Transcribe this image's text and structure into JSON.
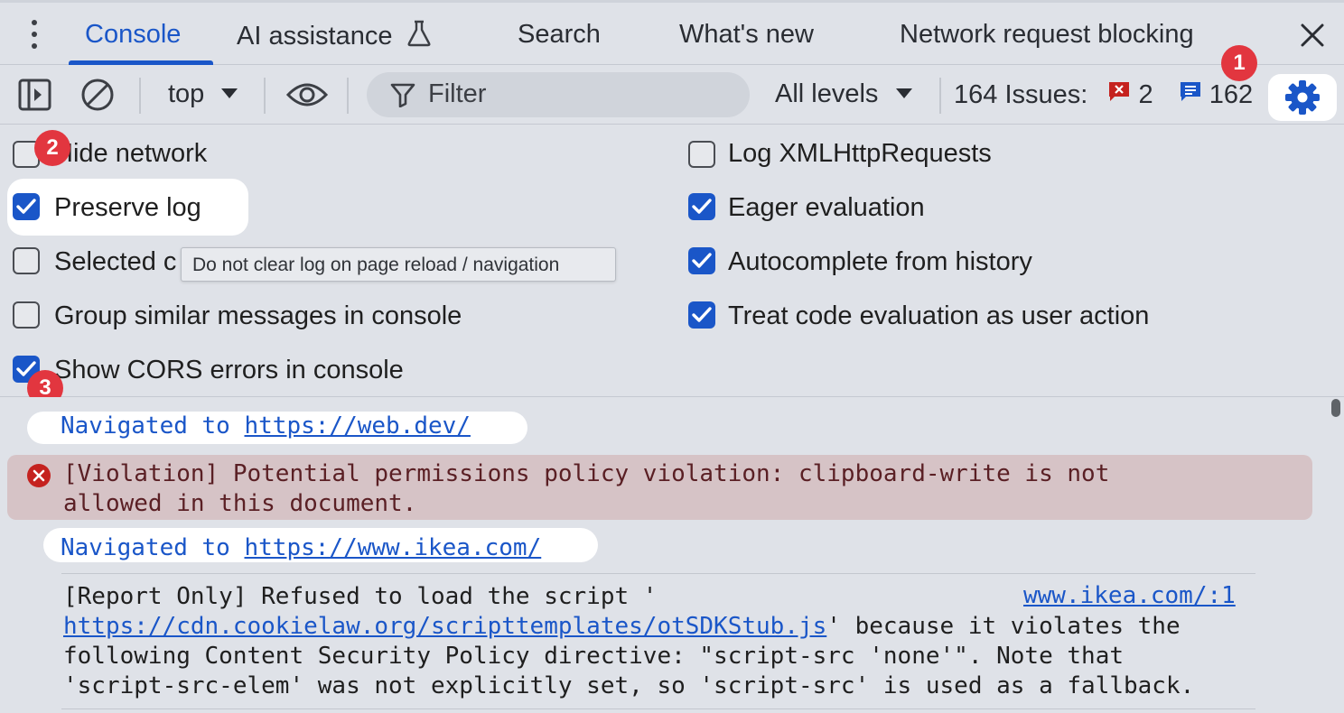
{
  "tabs": {
    "items": [
      {
        "label": "Console",
        "active": true
      },
      {
        "label": "AI assistance"
      },
      {
        "label": "Search"
      },
      {
        "label": "What's new"
      },
      {
        "label": "Network request blocking"
      }
    ]
  },
  "toolbar": {
    "context": "top",
    "filter_placeholder": "Filter",
    "levels": "All levels",
    "issues_label": "164 Issues:",
    "errors_count": "2",
    "info_count": "162"
  },
  "badges": {
    "one": "1",
    "two": "2",
    "three": "3"
  },
  "settings": {
    "left": [
      {
        "label": "Hide network",
        "checked": false
      },
      {
        "label": "Preserve log",
        "checked": true
      },
      {
        "label": "Selected c",
        "checked": false
      },
      {
        "label": "Group similar messages in console",
        "checked": false
      },
      {
        "label": "Show CORS errors in console",
        "checked": true
      }
    ],
    "right": [
      {
        "label": "Log XMLHttpRequests",
        "checked": false
      },
      {
        "label": "Eager evaluation",
        "checked": true
      },
      {
        "label": "Autocomplete from history",
        "checked": true
      },
      {
        "label": "Treat code evaluation as user action",
        "checked": true
      }
    ],
    "tooltip": "Do not clear log on page reload / navigation"
  },
  "console": {
    "nav1": {
      "prefix": "Navigated to ",
      "url": "https://web.dev/"
    },
    "violation": {
      "line1": "[Violation] Potential permissions policy violation: clipboard-write is not",
      "line2": "allowed in this document."
    },
    "nav2": {
      "prefix": "Navigated to ",
      "url": "https://www.ikea.com/"
    },
    "report": {
      "line1": "[Report Only] Refused to load the script '",
      "source": "www.ikea.com/:1",
      "line2_link": "https://cdn.cookielaw.org/scripttemplates/otSDKStub.js",
      "line2_rest": "' because it violates the",
      "line3": "following Content Security Policy directive: \"script-src 'none'\". Note that",
      "line4": "'script-src-elem' was not explicitly set, so 'script-src' is used as a fallback."
    }
  },
  "colors": {
    "accent": "#1a56c8",
    "badge": "#e2363f",
    "error": "#c5221f",
    "violation_bg": "#d6c3c6"
  }
}
